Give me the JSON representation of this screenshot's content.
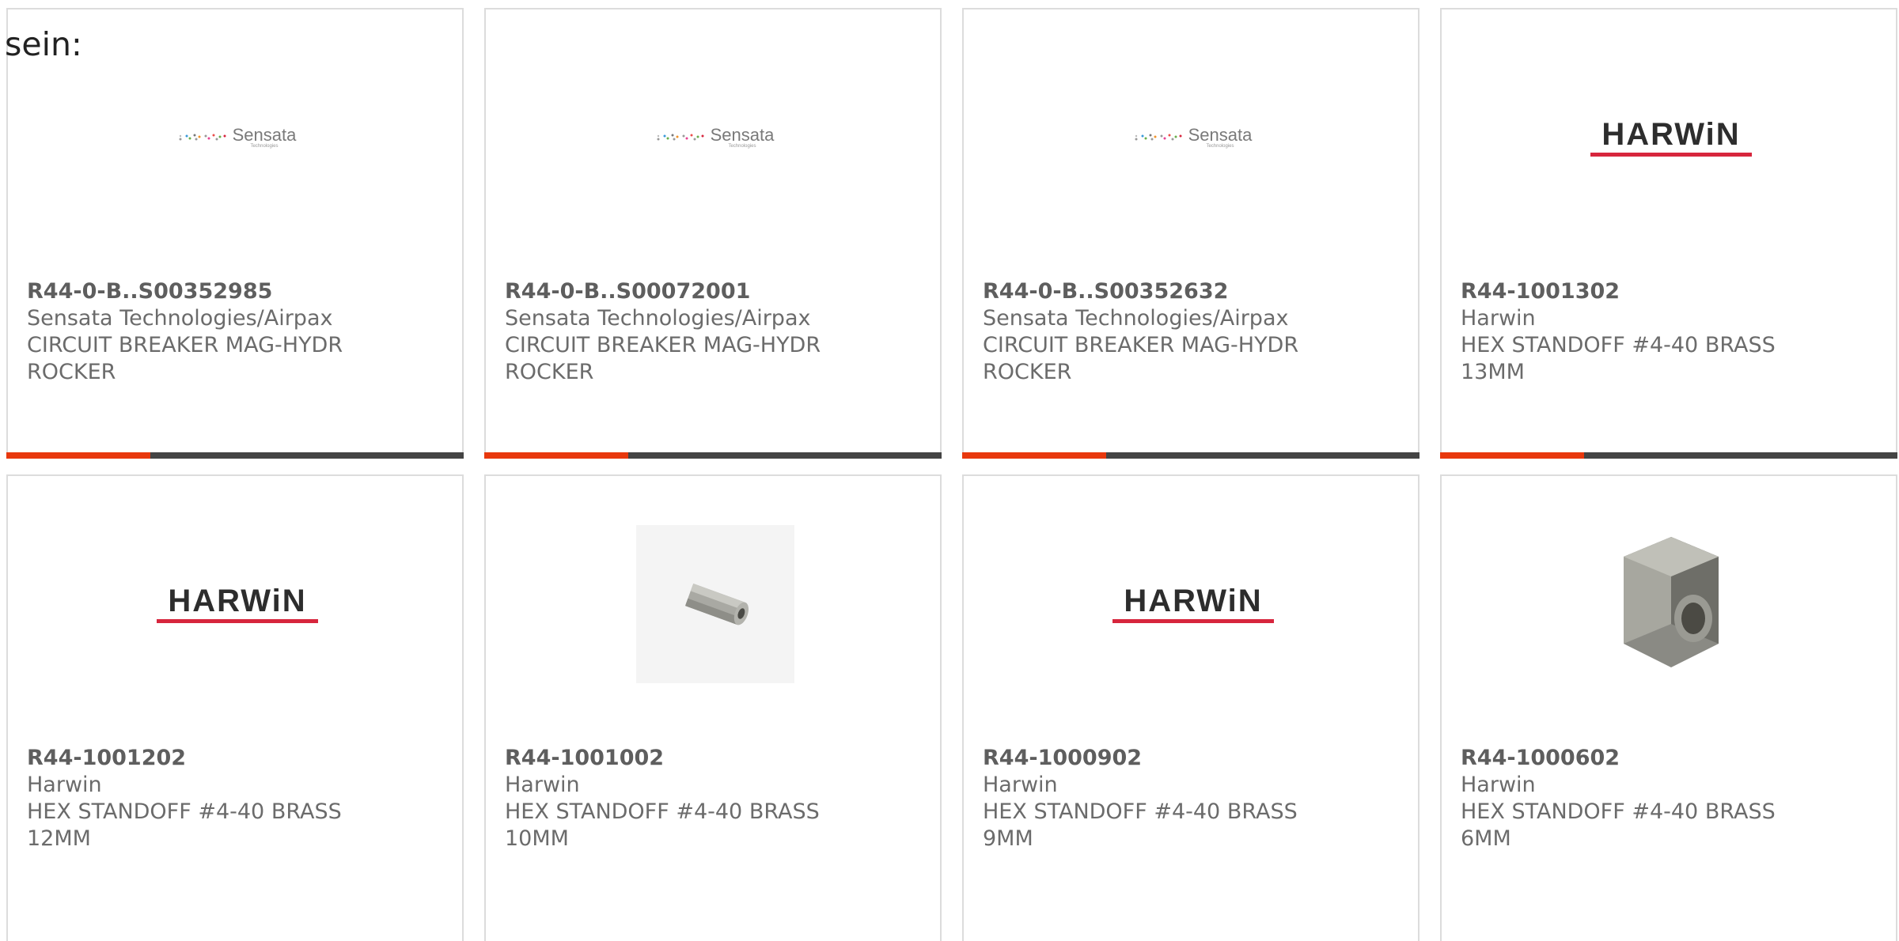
{
  "intro_text": "sein:",
  "colors": {
    "accent_red": "#e8380d",
    "accent_dark": "#444444",
    "harwin_red": "#d7263d"
  },
  "products": [
    {
      "part_number": "R44-0-B..S00352985",
      "manufacturer": "Sensata Technologies/Airpax",
      "desc_line1": "CIRCUIT BREAKER MAG-HYDR",
      "desc_line2": "ROCKER",
      "image": "sensata-logo",
      "logo_text": "Sensata",
      "logo_sub": "Technologies"
    },
    {
      "part_number": "R44-0-B..S00072001",
      "manufacturer": "Sensata Technologies/Airpax",
      "desc_line1": "CIRCUIT BREAKER MAG-HYDR",
      "desc_line2": "ROCKER",
      "image": "sensata-logo",
      "logo_text": "Sensata",
      "logo_sub": "Technologies"
    },
    {
      "part_number": "R44-0-B..S00352632",
      "manufacturer": "Sensata Technologies/Airpax",
      "desc_line1": "CIRCUIT BREAKER MAG-HYDR",
      "desc_line2": "ROCKER",
      "image": "sensata-logo",
      "logo_text": "Sensata",
      "logo_sub": "Technologies"
    },
    {
      "part_number": "R44-1001302",
      "manufacturer": "Harwin",
      "desc_line1": "HEX STANDOFF #4-40 BRASS",
      "desc_line2": "13MM",
      "image": "harwin-logo",
      "logo_text": "HARWiN"
    },
    {
      "part_number": "R44-1001202",
      "manufacturer": "Harwin",
      "desc_line1": "HEX STANDOFF #4-40 BRASS",
      "desc_line2": "12MM",
      "image": "harwin-logo",
      "logo_text": "HARWiN"
    },
    {
      "part_number": "R44-1001002",
      "manufacturer": "Harwin",
      "desc_line1": "HEX STANDOFF #4-40 BRASS",
      "desc_line2": "10MM",
      "image": "hex-standoff-long"
    },
    {
      "part_number": "R44-1000902",
      "manufacturer": "Harwin",
      "desc_line1": "HEX STANDOFF #4-40 BRASS",
      "desc_line2": "9MM",
      "image": "harwin-logo",
      "logo_text": "HARWiN"
    },
    {
      "part_number": "R44-1000602",
      "manufacturer": "Harwin",
      "desc_line1": "HEX STANDOFF #4-40 BRASS",
      "desc_line2": "6MM",
      "image": "hex-standoff-short"
    }
  ]
}
